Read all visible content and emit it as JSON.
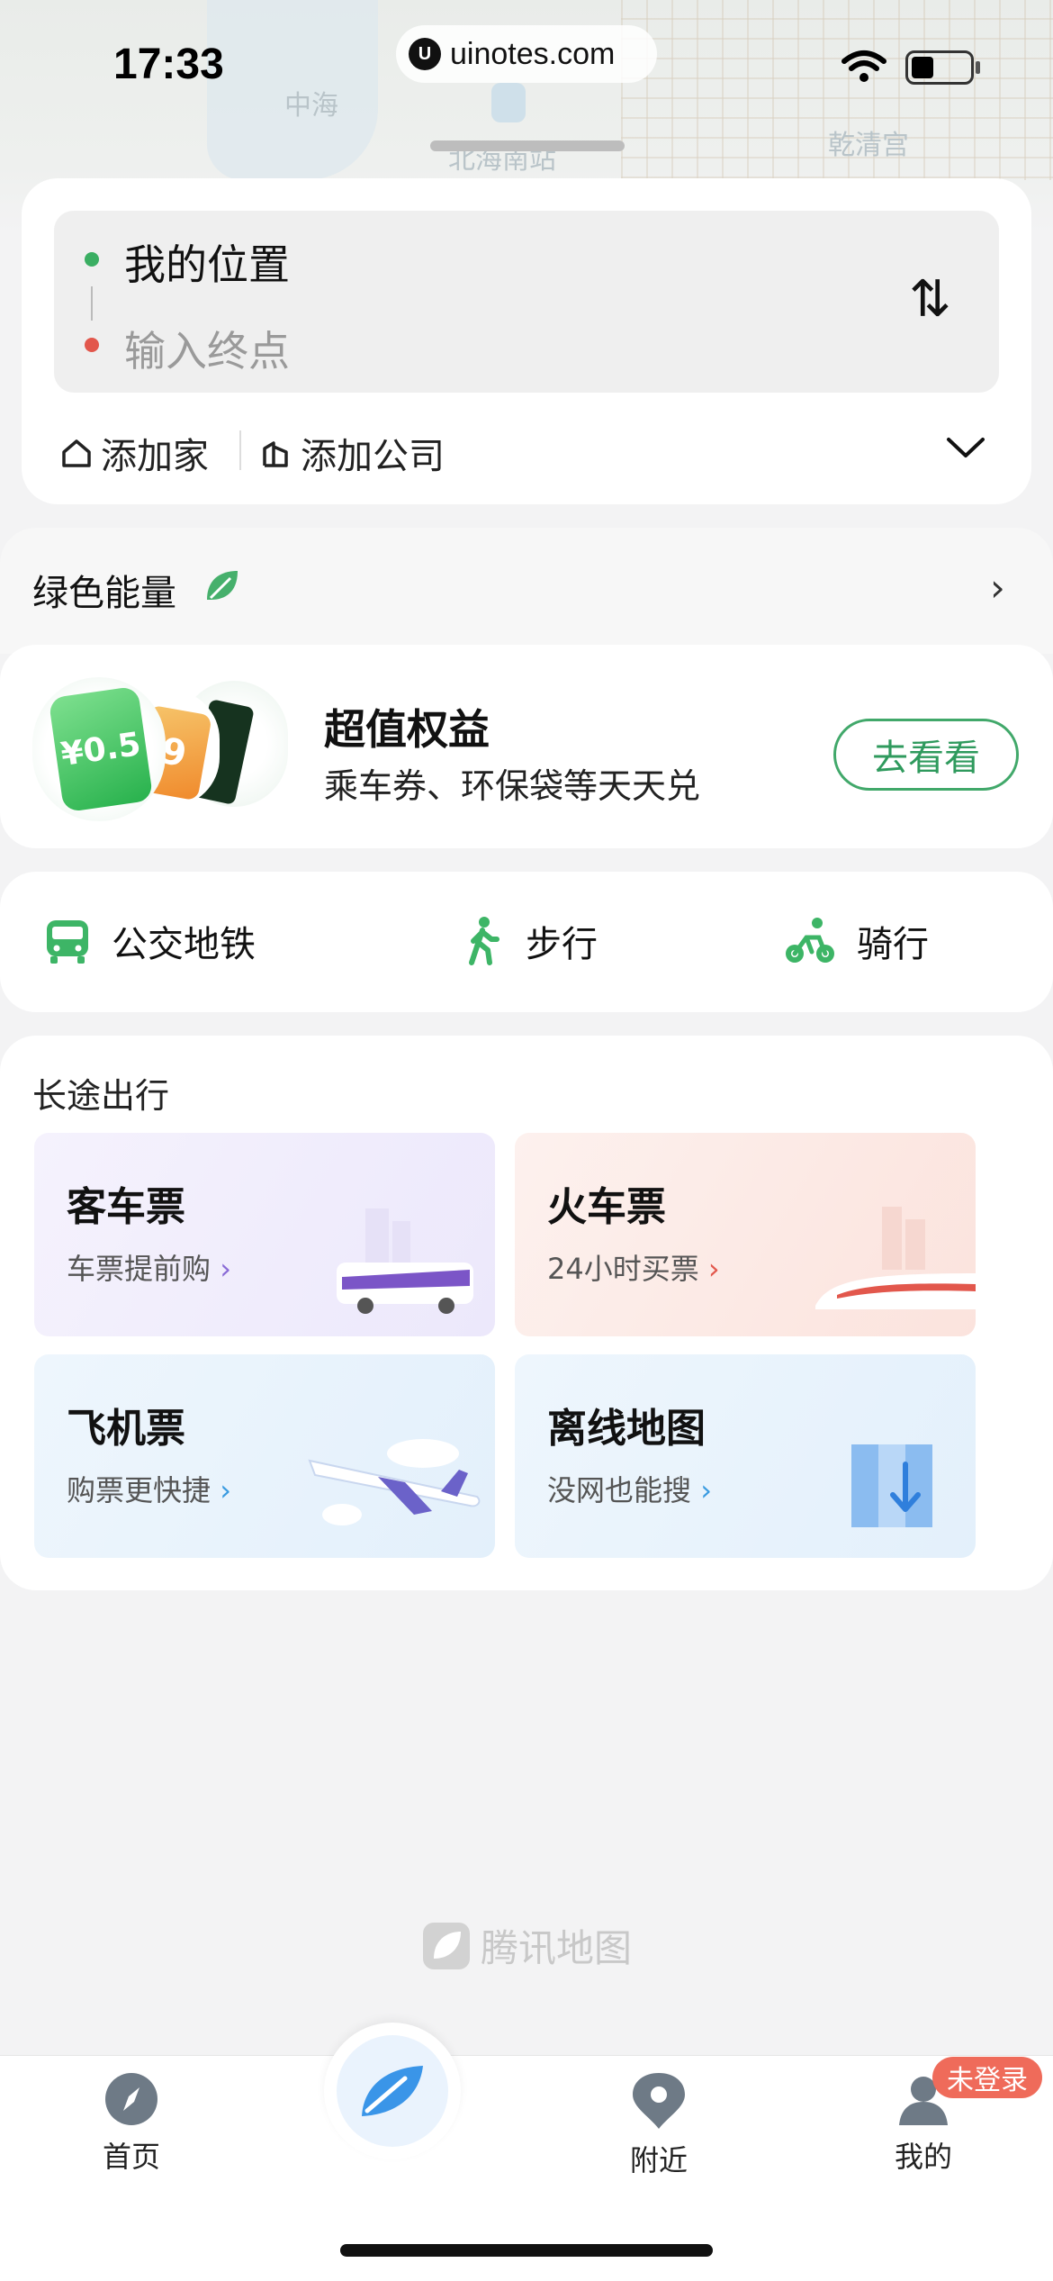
{
  "status_bar": {
    "time": "17:33",
    "url": "uinotes.com"
  },
  "map": {
    "labels": [
      "中海",
      "北海南站",
      "乾清宫"
    ]
  },
  "route": {
    "origin": "我的位置",
    "destination_placeholder": "输入终点",
    "quick_links": [
      {
        "label": "添加家",
        "icon": "home-icon"
      },
      {
        "label": "添加公司",
        "icon": "office-icon"
      }
    ]
  },
  "green_energy": {
    "title": "绿色能量"
  },
  "promo": {
    "title": "超值权益",
    "subtitle": "乘车券、环保袋等天天兑",
    "button": "去看看",
    "coupon_value": "¥0.5",
    "coupon_partial": "9",
    "accent": "#41a86a"
  },
  "modes": [
    {
      "label": "公交地铁",
      "icon": "bus-icon"
    },
    {
      "label": "步行",
      "icon": "walk-icon"
    },
    {
      "label": "骑行",
      "icon": "bike-icon"
    }
  ],
  "long_trip": {
    "title": "长途出行",
    "tiles": [
      {
        "title": "客车票",
        "subtitle": "车票提前购",
        "arrow": "›",
        "icon": "coach-bus-icon"
      },
      {
        "title": "火车票",
        "subtitle": "24小时买票",
        "arrow": "›",
        "icon": "train-icon"
      },
      {
        "title": "飞机票",
        "subtitle": "购票更快捷",
        "arrow": "›",
        "icon": "airplane-icon"
      },
      {
        "title": "离线地图",
        "subtitle": "没网也能搜",
        "arrow": "›",
        "icon": "offline-map-icon"
      }
    ]
  },
  "watermark": "腾讯地图",
  "tabbar": {
    "tabs": [
      {
        "label": "首页"
      },
      {
        "label": ""
      },
      {
        "label": "附近"
      },
      {
        "label": "我的"
      }
    ],
    "badge": "未登录"
  }
}
